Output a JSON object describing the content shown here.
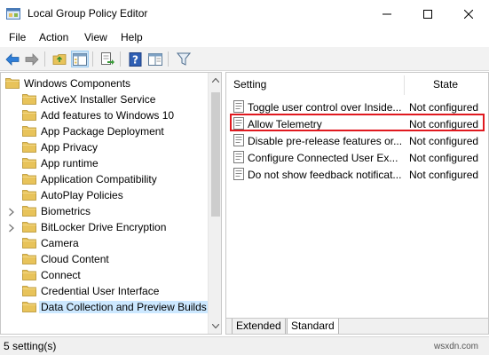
{
  "window": {
    "title": "Local Group Policy Editor"
  },
  "menu": [
    "File",
    "Action",
    "View",
    "Help"
  ],
  "toolbar": {
    "icons": [
      "back-arrow-icon",
      "forward-arrow-icon",
      "up-folder-icon",
      "show-hide-tree-icon",
      "export-list-icon",
      "help-icon",
      "extended-view-icon",
      "filter-icon"
    ]
  },
  "tree": {
    "items": [
      {
        "label": "Windows Components",
        "level": 0,
        "expander": "",
        "selected": false
      },
      {
        "label": "ActiveX Installer Service",
        "level": 1,
        "expander": "",
        "selected": false
      },
      {
        "label": "Add features to Windows 10",
        "level": 1,
        "expander": "",
        "selected": false
      },
      {
        "label": "App Package Deployment",
        "level": 1,
        "expander": "",
        "selected": false
      },
      {
        "label": "App Privacy",
        "level": 1,
        "expander": "",
        "selected": false
      },
      {
        "label": "App runtime",
        "level": 1,
        "expander": "",
        "selected": false
      },
      {
        "label": "Application Compatibility",
        "level": 1,
        "expander": "",
        "selected": false
      },
      {
        "label": "AutoPlay Policies",
        "level": 1,
        "expander": "",
        "selected": false
      },
      {
        "label": "Biometrics",
        "level": 1,
        "expander": "collapsed",
        "selected": false
      },
      {
        "label": "BitLocker Drive Encryption",
        "level": 1,
        "expander": "collapsed",
        "selected": false
      },
      {
        "label": "Camera",
        "level": 1,
        "expander": "",
        "selected": false
      },
      {
        "label": "Cloud Content",
        "level": 1,
        "expander": "",
        "selected": false
      },
      {
        "label": "Connect",
        "level": 1,
        "expander": "",
        "selected": false
      },
      {
        "label": "Credential User Interface",
        "level": 1,
        "expander": "",
        "selected": false
      },
      {
        "label": "Data Collection and Preview Builds",
        "level": 1,
        "expander": "",
        "selected": true
      }
    ]
  },
  "list": {
    "columns": {
      "setting": "Setting",
      "state": "State"
    },
    "rows": [
      {
        "setting": "Toggle user control over Insider builds",
        "state": "Not configured",
        "highlighted": false
      },
      {
        "setting": "Allow Telemetry",
        "state": "Not configured",
        "highlighted": true
      },
      {
        "setting": "Disable pre-release features or settings",
        "state": "Not configured",
        "highlighted": false
      },
      {
        "setting": "Configure Connected User Experiences",
        "state": "Not configured",
        "highlighted": false
      },
      {
        "setting": "Do not show feedback notifications",
        "state": "Not configured",
        "highlighted": false
      }
    ],
    "tabs": [
      {
        "label": "Extended",
        "active": false
      },
      {
        "label": "Standard",
        "active": true
      }
    ]
  },
  "status": {
    "text": "5 setting(s)",
    "watermark": "wsxdn.com"
  },
  "colors": {
    "selection": "#cce8ff",
    "highlight_border": "#e0191f",
    "folder": "#e8c35a"
  }
}
